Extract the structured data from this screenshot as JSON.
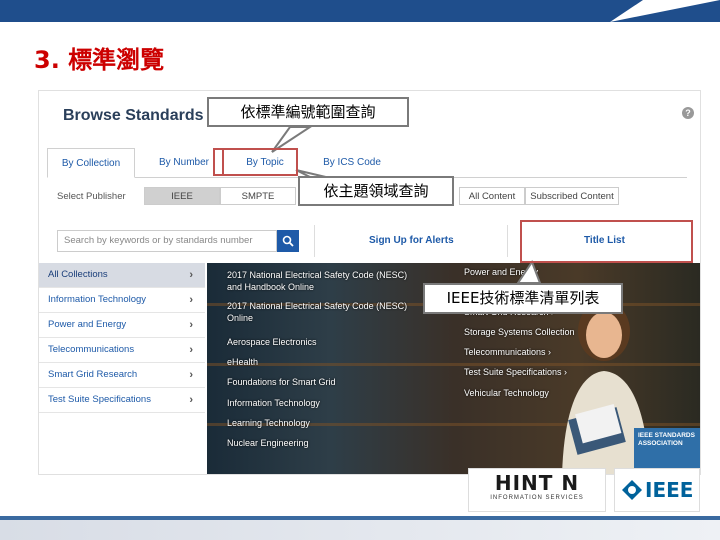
{
  "slide": {
    "title": "3. 標準瀏覽"
  },
  "page": {
    "title": "Browse Standards",
    "help_icon": "?",
    "tabs": [
      {
        "label": "By Collection",
        "active": true
      },
      {
        "label": "By Number",
        "active": false
      },
      {
        "label": "By Topic",
        "active": false
      },
      {
        "label": "By ICS Code",
        "active": false
      }
    ],
    "publisher_label": "Select Publisher",
    "publishers": [
      "IEEE",
      "SMPTE"
    ],
    "content_filters": [
      "All Content",
      "Subscribed Content"
    ],
    "search": {
      "placeholder": "Search by keywords or by standards number",
      "button_icon": "search-icon"
    },
    "links": {
      "alerts": "Sign Up for Alerts",
      "title_list": "Title List"
    },
    "sidebar": [
      {
        "label": "All Collections",
        "active": true
      },
      {
        "label": "Information Technology",
        "active": false
      },
      {
        "label": "Power and Energy",
        "active": false
      },
      {
        "label": "Telecommunications",
        "active": false
      },
      {
        "label": "Smart Grid Research",
        "active": false
      },
      {
        "label": "Test Suite Specifications",
        "active": false
      }
    ],
    "chevron": "›",
    "collections_left": [
      "2017 National Electrical Safety Code (NESC)",
      "and Handbook Online",
      "2017 National Electrical Safety Code (NESC)",
      "Online",
      "Aerospace Electronics",
      "eHealth",
      "Foundations for Smart Grid",
      "Information Technology",
      "Learning Technology",
      "Nuclear Engineering"
    ],
    "collections_right": [
      "Power and Energy",
      "Smart Grid Research ›",
      "Storage Systems Collection",
      "Telecommunications ›",
      "Test Suite Specifications ›",
      "Vehicular Technology"
    ],
    "badge": {
      "line1": "IEEE STANDARDS",
      "line2": "ASSOCIATION"
    }
  },
  "callouts": {
    "number_range": "依標準編號範圍查詢",
    "topic": "依主題領域查詢",
    "title_list": "IEEE技術標準清單列表"
  },
  "logos": {
    "hinton_main": "HINT N",
    "hinton_sub": "INFORMATION SERVICES",
    "ieee": "IEEE"
  },
  "colors": {
    "title_red": "#cc0000",
    "link_blue": "#1e5aa8",
    "callout_red": "#c0504d",
    "band_blue": "#1f4e8c"
  }
}
